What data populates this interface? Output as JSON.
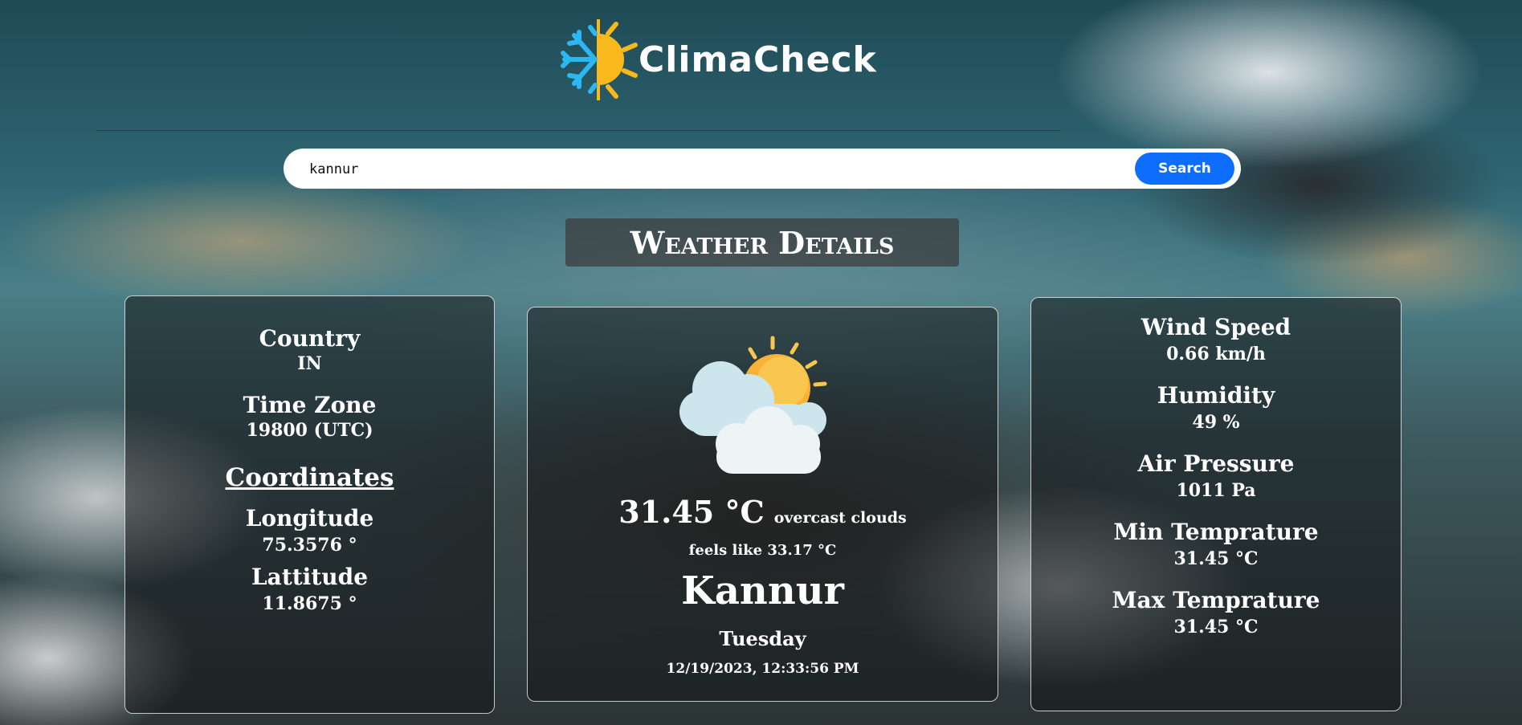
{
  "app": {
    "name": "ClimaCheck",
    "logo_icon": "snowflake-sun-icon"
  },
  "search": {
    "value": "kannur",
    "placeholder": "",
    "button_label": "Search",
    "button_color": "#0d6efd"
  },
  "section_title": "Weather Details",
  "left_card": {
    "country_label": "Country",
    "country_value": "IN",
    "timezone_label": "Time Zone",
    "timezone_value": "19800 (UTC)",
    "coordinates_heading": "Coordinates",
    "longitude_label": "Longitude",
    "longitude_value": "75.3576 °",
    "latitude_label": "Lattitude",
    "latitude_value": "11.8675 °"
  },
  "center_card": {
    "icon": "sun-behind-clouds-icon",
    "temperature": "31.45 °C",
    "description": "overcast clouds",
    "feels_like": "feels like 33.17 °C",
    "city": "Kannur",
    "day": "Tuesday",
    "datetime": "12/19/2023, 12:33:56 PM"
  },
  "right_card": {
    "wind_label": "Wind Speed",
    "wind_value": "0.66 km/h",
    "humidity_label": "Humidity",
    "humidity_value": "49 %",
    "pressure_label": "Air Pressure",
    "pressure_value": "1011 Pa",
    "min_label": "Min Temprature",
    "min_value": "31.45 °C",
    "max_label": "Max Temprature",
    "max_value": "31.45 °C"
  }
}
